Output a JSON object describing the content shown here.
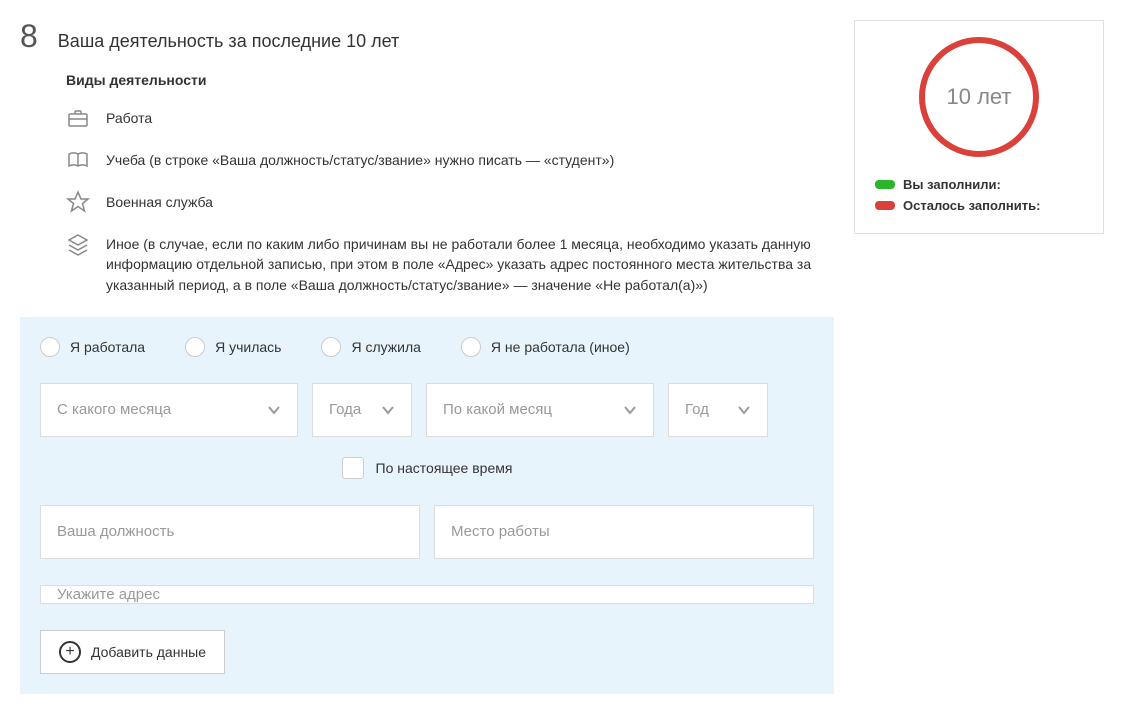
{
  "section": {
    "number": "8",
    "title": "Ваша деятельность за последние 10 лет"
  },
  "types_heading": "Виды деятельности",
  "types": {
    "work": "Работа",
    "study": "Учеба (в строке «Ваша должность/статус/звание» нужно писать — «студент»)",
    "military": "Военная служба",
    "other": "Иное (в случае, если по каким либо причинам вы не работали более 1 месяца, необходимо указать данную информацию отдельной записью, при этом в поле «Адрес» указать адрес постоянного места жительства за указанный период, а в поле «Ваша должность/статус/звание» — значение «Не работал(а)»)"
  },
  "form": {
    "radios": {
      "worked": "Я работала",
      "studied": "Я училась",
      "served": "Я служила",
      "none": "Я не работала (иное)"
    },
    "selects": {
      "month_from": "С какого месяца",
      "year_from": "Года",
      "month_to": "По какой месяц",
      "year_to": "Год"
    },
    "checkbox_current": "По настоящее время",
    "inputs": {
      "position": "Ваша должность",
      "workplace": "Место работы",
      "address": "Укажите адрес"
    },
    "add_button": "Добавить данные"
  },
  "sidebar": {
    "progress_label": "10 лет",
    "legend_filled": "Вы заполнили:",
    "legend_remaining": "Осталось заполнить:"
  }
}
